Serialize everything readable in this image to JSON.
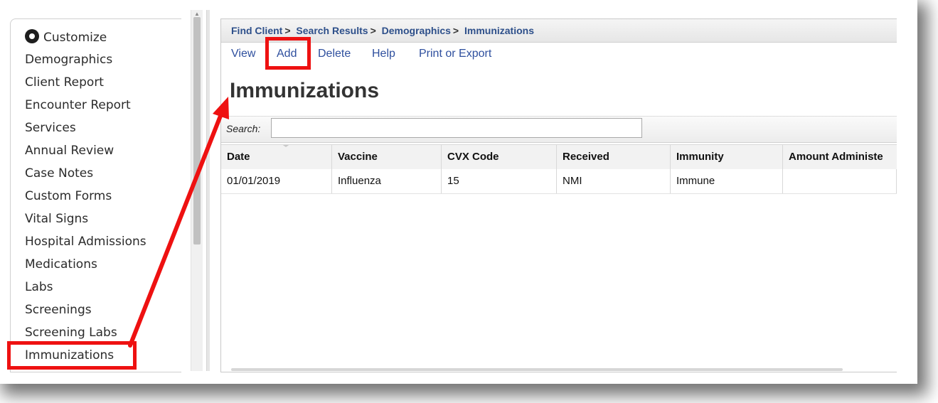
{
  "sidebar": {
    "customize_label": "Customize",
    "items": [
      {
        "label": "Demographics"
      },
      {
        "label": "Client Report"
      },
      {
        "label": "Encounter Report"
      },
      {
        "label": "Services"
      },
      {
        "label": "Annual Review"
      },
      {
        "label": "Case Notes"
      },
      {
        "label": "Custom Forms"
      },
      {
        "label": "Vital Signs"
      },
      {
        "label": "Hospital Admissions"
      },
      {
        "label": "Medications"
      },
      {
        "label": "Labs"
      },
      {
        "label": "Screenings"
      },
      {
        "label": "Screening Labs"
      },
      {
        "label": "Immunizations"
      }
    ]
  },
  "breadcrumb": {
    "items": [
      "Find Client",
      "Search Results",
      "Demographics",
      "Immunizations"
    ],
    "separator": ">"
  },
  "toolbar": {
    "view_label": "View",
    "add_label": "Add",
    "delete_label": "Delete",
    "help_label": "Help",
    "print_label": "Print or Export"
  },
  "page": {
    "title": "Immunizations"
  },
  "search": {
    "label": "Search:",
    "value": ""
  },
  "table": {
    "columns": [
      "Date",
      "Vaccine",
      "CVX Code",
      "Received",
      "Immunity",
      "Amount Administe"
    ],
    "rows": [
      [
        "01/01/2019",
        "Influenza",
        "15",
        "NMI",
        "Immune",
        ""
      ]
    ]
  },
  "annotation": {
    "color": "#ee1111"
  },
  "icons": {
    "customize": "gear-icon",
    "sort": "sort-caret-icon"
  }
}
